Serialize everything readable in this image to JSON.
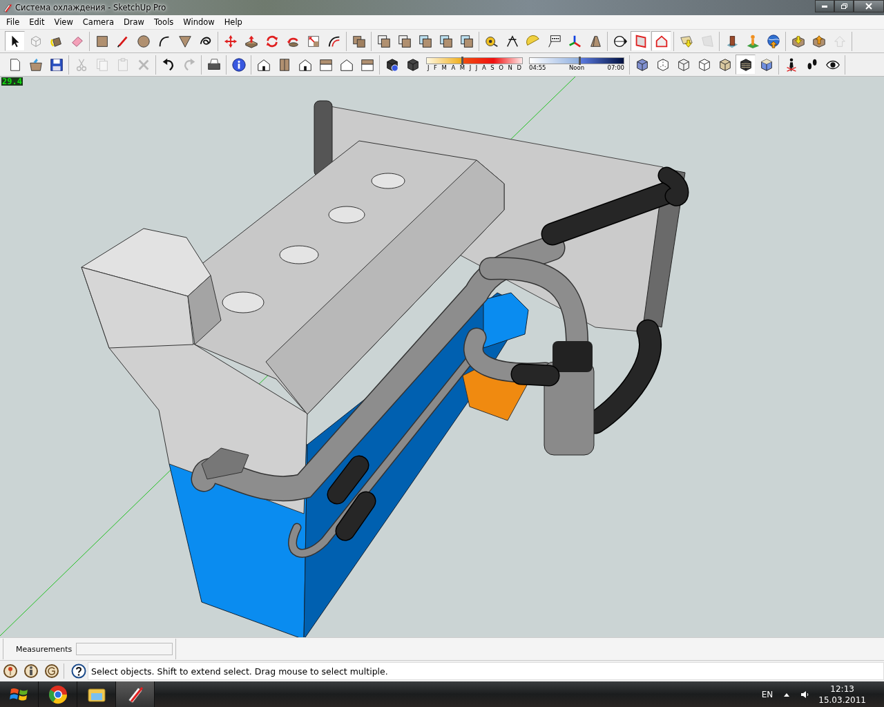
{
  "window": {
    "title": "Система охлаждения - SketchUp Pro"
  },
  "menu": [
    {
      "label": "File"
    },
    {
      "label": "Edit"
    },
    {
      "label": "View"
    },
    {
      "label": "Camera"
    },
    {
      "label": "Draw"
    },
    {
      "label": "Tools"
    },
    {
      "label": "Window"
    },
    {
      "label": "Help"
    }
  ],
  "toolbar_1": {
    "tools": [
      {
        "pressed": true,
        "disabled": false
      },
      {
        "pressed": false,
        "disabled": false
      },
      {
        "pressed": false,
        "disabled": false
      },
      {
        "pressed": false,
        "disabled": false
      },
      {
        "pressed": false,
        "disabled": false
      },
      {
        "pressed": false,
        "disabled": false
      },
      {
        "pressed": false,
        "disabled": false
      },
      {
        "pressed": false,
        "disabled": false
      },
      {
        "pressed": false,
        "disabled": false
      },
      {
        "pressed": false,
        "disabled": false
      },
      {
        "pressed": false,
        "disabled": false
      },
      {
        "pressed": false,
        "disabled": false
      },
      {
        "pressed": false,
        "disabled": false
      },
      {
        "pressed": false,
        "disabled": false
      },
      {
        "pressed": false,
        "disabled": false
      },
      {
        "pressed": false,
        "disabled": false
      },
      {
        "pressed": false,
        "disabled": false
      },
      {
        "pressed": false,
        "disabled": false
      },
      {
        "pressed": false,
        "disabled": false
      },
      {
        "pressed": false,
        "disabled": false
      },
      {
        "pressed": false,
        "disabled": false
      },
      {
        "pressed": false,
        "disabled": false
      },
      {
        "pressed": false,
        "disabled": false
      },
      {
        "pressed": false,
        "disabled": false
      },
      {
        "pressed": false,
        "disabled": false
      },
      {
        "pressed": false,
        "disabled": false
      },
      {
        "pressed": false,
        "disabled": false
      },
      {
        "pressed": false,
        "disabled": false
      },
      {
        "pressed": false,
        "disabled": false
      },
      {
        "pressed": true,
        "disabled": false
      },
      {
        "pressed": true,
        "disabled": false
      },
      {
        "pressed": false,
        "disabled": false
      },
      {
        "pressed": false,
        "disabled": true
      },
      {
        "pressed": false,
        "disabled": false
      },
      {
        "pressed": false,
        "disabled": false
      },
      {
        "pressed": false,
        "disabled": false
      },
      {
        "pressed": false,
        "disabled": false
      },
      {
        "pressed": false,
        "disabled": false
      },
      {
        "pressed": false,
        "disabled": true
      }
    ]
  },
  "toolbar_2": {
    "tools": [
      {
        "pressed": false,
        "disabled": false
      },
      {
        "pressed": false,
        "disabled": false
      },
      {
        "pressed": false,
        "disabled": false
      },
      {
        "pressed": false,
        "disabled": true
      },
      {
        "pressed": false,
        "disabled": true
      },
      {
        "pressed": false,
        "disabled": true
      },
      {
        "pressed": false,
        "disabled": true
      },
      {
        "pressed": false,
        "disabled": false
      },
      {
        "pressed": false,
        "disabled": true
      },
      {
        "pressed": false,
        "disabled": false
      },
      {
        "pressed": false,
        "disabled": false
      },
      {
        "pressed": false,
        "disabled": false
      },
      {
        "pressed": false,
        "disabled": false
      },
      {
        "pressed": false,
        "disabled": false
      },
      {
        "pressed": false,
        "disabled": false
      },
      {
        "pressed": false,
        "disabled": false
      },
      {
        "pressed": false,
        "disabled": false
      },
      {
        "pressed": false,
        "disabled": false
      },
      {
        "pressed": false,
        "disabled": false
      }
    ],
    "shadow_months": {
      "labels": [
        "J",
        "F",
        "M",
        "A",
        "M",
        "J",
        "J",
        "A",
        "S",
        "O",
        "N",
        "D"
      ],
      "level": 0.36
    },
    "shadow_time": {
      "start": "04:55",
      "middle": "Noon",
      "end": "07:00",
      "level": 0.52
    },
    "style_tools": [
      {
        "pressed": false,
        "disabled": false
      },
      {
        "pressed": false,
        "disabled": false
      },
      {
        "pressed": false,
        "disabled": false
      },
      {
        "pressed": false,
        "disabled": false
      },
      {
        "pressed": false,
        "disabled": false
      },
      {
        "pressed": true,
        "disabled": false
      },
      {
        "pressed": false,
        "disabled": false
      },
      {
        "pressed": false,
        "disabled": false
      },
      {
        "pressed": false,
        "disabled": false
      },
      {
        "pressed": false,
        "disabled": false
      }
    ]
  },
  "viewport": {
    "value_display": "29.4"
  },
  "measurements": {
    "label": "Measurements"
  },
  "status_bar": {
    "message": "Select objects. Shift to extend select. Drag mouse to select multiple."
  },
  "taskbar": {
    "language": "EN",
    "time": "12:13",
    "date": "15.03.2011"
  }
}
